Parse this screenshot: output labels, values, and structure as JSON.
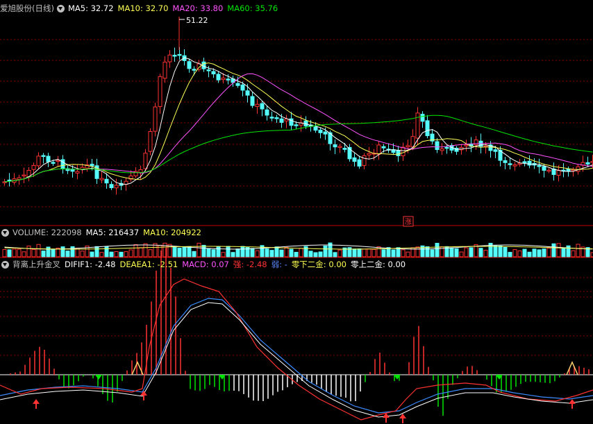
{
  "colors": {
    "bg": "#000000",
    "up": "#ff3232",
    "down": "#54fcfc",
    "ma5": "#ffffff",
    "ma10": "#ffff54",
    "ma20": "#ff54ff",
    "ma60": "#00e600",
    "grid": "#8b0000",
    "vol_ma10": "#ffff54",
    "diff": "#ffffff",
    "dea": "#ffff54",
    "macd_up": "#ff3232",
    "macd_down": "#00e600",
    "buy_arrow": "#ff3232",
    "sell_arrow": "#00e600"
  },
  "price_panel": {
    "stock": "爱旭股份(日线)",
    "ma5": "MA5: 32.72",
    "ma10": "MA10: 32.70",
    "ma20": "MA20: 33.80",
    "ma60": "MA60: 35.76",
    "high_label": "51.22",
    "zhang_label": "涨"
  },
  "volume_panel": {
    "vol": "VOLUME: 222098",
    "ma5": "MA5: 216437",
    "ma10": "MA10: 204922"
  },
  "indicator_panel": {
    "name": "背离上升金叉",
    "dif": "DIFIF1: -2.48",
    "dea": "DEAEA1: -2.51",
    "macd": "MACD: 0.07",
    "strong": "强: -2.48",
    "weak": "弱: -",
    "zero_down": "零下二金: 0.00",
    "zero_up": "零上二金: 0.00"
  },
  "chart_data": [
    {
      "type": "candlestick",
      "title": "爱旭股份(日线)",
      "highlighted_high": 51.22,
      "legend": [
        "MA5: 32.72",
        "MA10: 32.70",
        "MA20: 33.80",
        "MA60: 35.76"
      ],
      "series": [
        {
          "name": "MA5",
          "value": 32.72
        },
        {
          "name": "MA10",
          "value": 32.7
        },
        {
          "name": "MA20",
          "value": 33.8
        },
        {
          "name": "MA60",
          "value": 35.76
        }
      ]
    },
    {
      "type": "bar",
      "title": "VOLUME",
      "series": [
        {
          "name": "VOLUME",
          "value": 222098
        },
        {
          "name": "MA5",
          "value": 216437
        },
        {
          "name": "MA10",
          "value": 204922
        }
      ]
    },
    {
      "type": "line",
      "title": "背离上升金叉",
      "series": [
        {
          "name": "DIFIF1",
          "value": -2.48
        },
        {
          "name": "DEAEA1",
          "value": -2.51
        },
        {
          "name": "MACD",
          "value": 0.07
        }
      ]
    }
  ]
}
